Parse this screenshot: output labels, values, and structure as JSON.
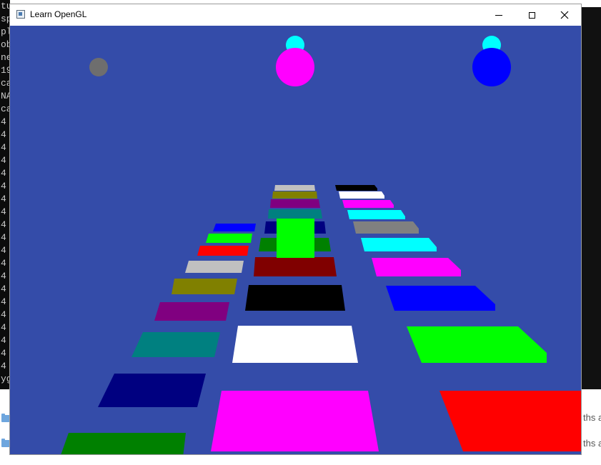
{
  "console": {
    "lines": [
      "tu",
      "sp",
      "pl",
      "ob",
      "ne",
      "19",
      "ca",
      "NA",
      "ca",
      "4",
      "4",
      "4",
      "4",
      "4",
      "4",
      "4",
      "4",
      "4",
      "4",
      "4",
      "4",
      "4",
      "4",
      "4",
      "4",
      "4",
      "4",
      "4",
      "4",
      "yg"
    ]
  },
  "explorer": {
    "rows": [
      {
        "text": "ths a"
      },
      {
        "text": "ths a"
      }
    ]
  },
  "window": {
    "title": "Learn OpenGL",
    "controls": {
      "minimize": "Minimize",
      "maximize": "Maximize",
      "close": "Close"
    }
  },
  "scene": {
    "background_color": "#344ca9",
    "lights": [
      {
        "name": "gray-sphere",
        "color": "#6e6e6e"
      },
      {
        "name": "magenta-sphere",
        "color": "#ff00ff",
        "cap_color": "#00ffff"
      },
      {
        "name": "blue-sphere",
        "color": "#0000ff",
        "cap_color": "#00ffff"
      }
    ],
    "player_cube": {
      "color": "#00ff00"
    },
    "lanes": {
      "left": [
        "#008000",
        "#000080",
        "#008080",
        "#800080",
        "#808000",
        "#c0c0c0",
        "#ff0000",
        "#00ff00",
        "#0000ff"
      ],
      "center": [
        "#ff00ff",
        "#ffffff",
        "#000000",
        "#800000",
        "#008000",
        "#000080",
        "#008080",
        "#800080",
        "#808000",
        "#c0c0c0"
      ],
      "right": [
        "#ff0000",
        "#00ff00",
        "#0000ff",
        "#ff00ff",
        "#00ffff",
        "#808080",
        "#00ffff",
        "#ff00ff",
        "#ffffff",
        "#000000"
      ]
    }
  }
}
